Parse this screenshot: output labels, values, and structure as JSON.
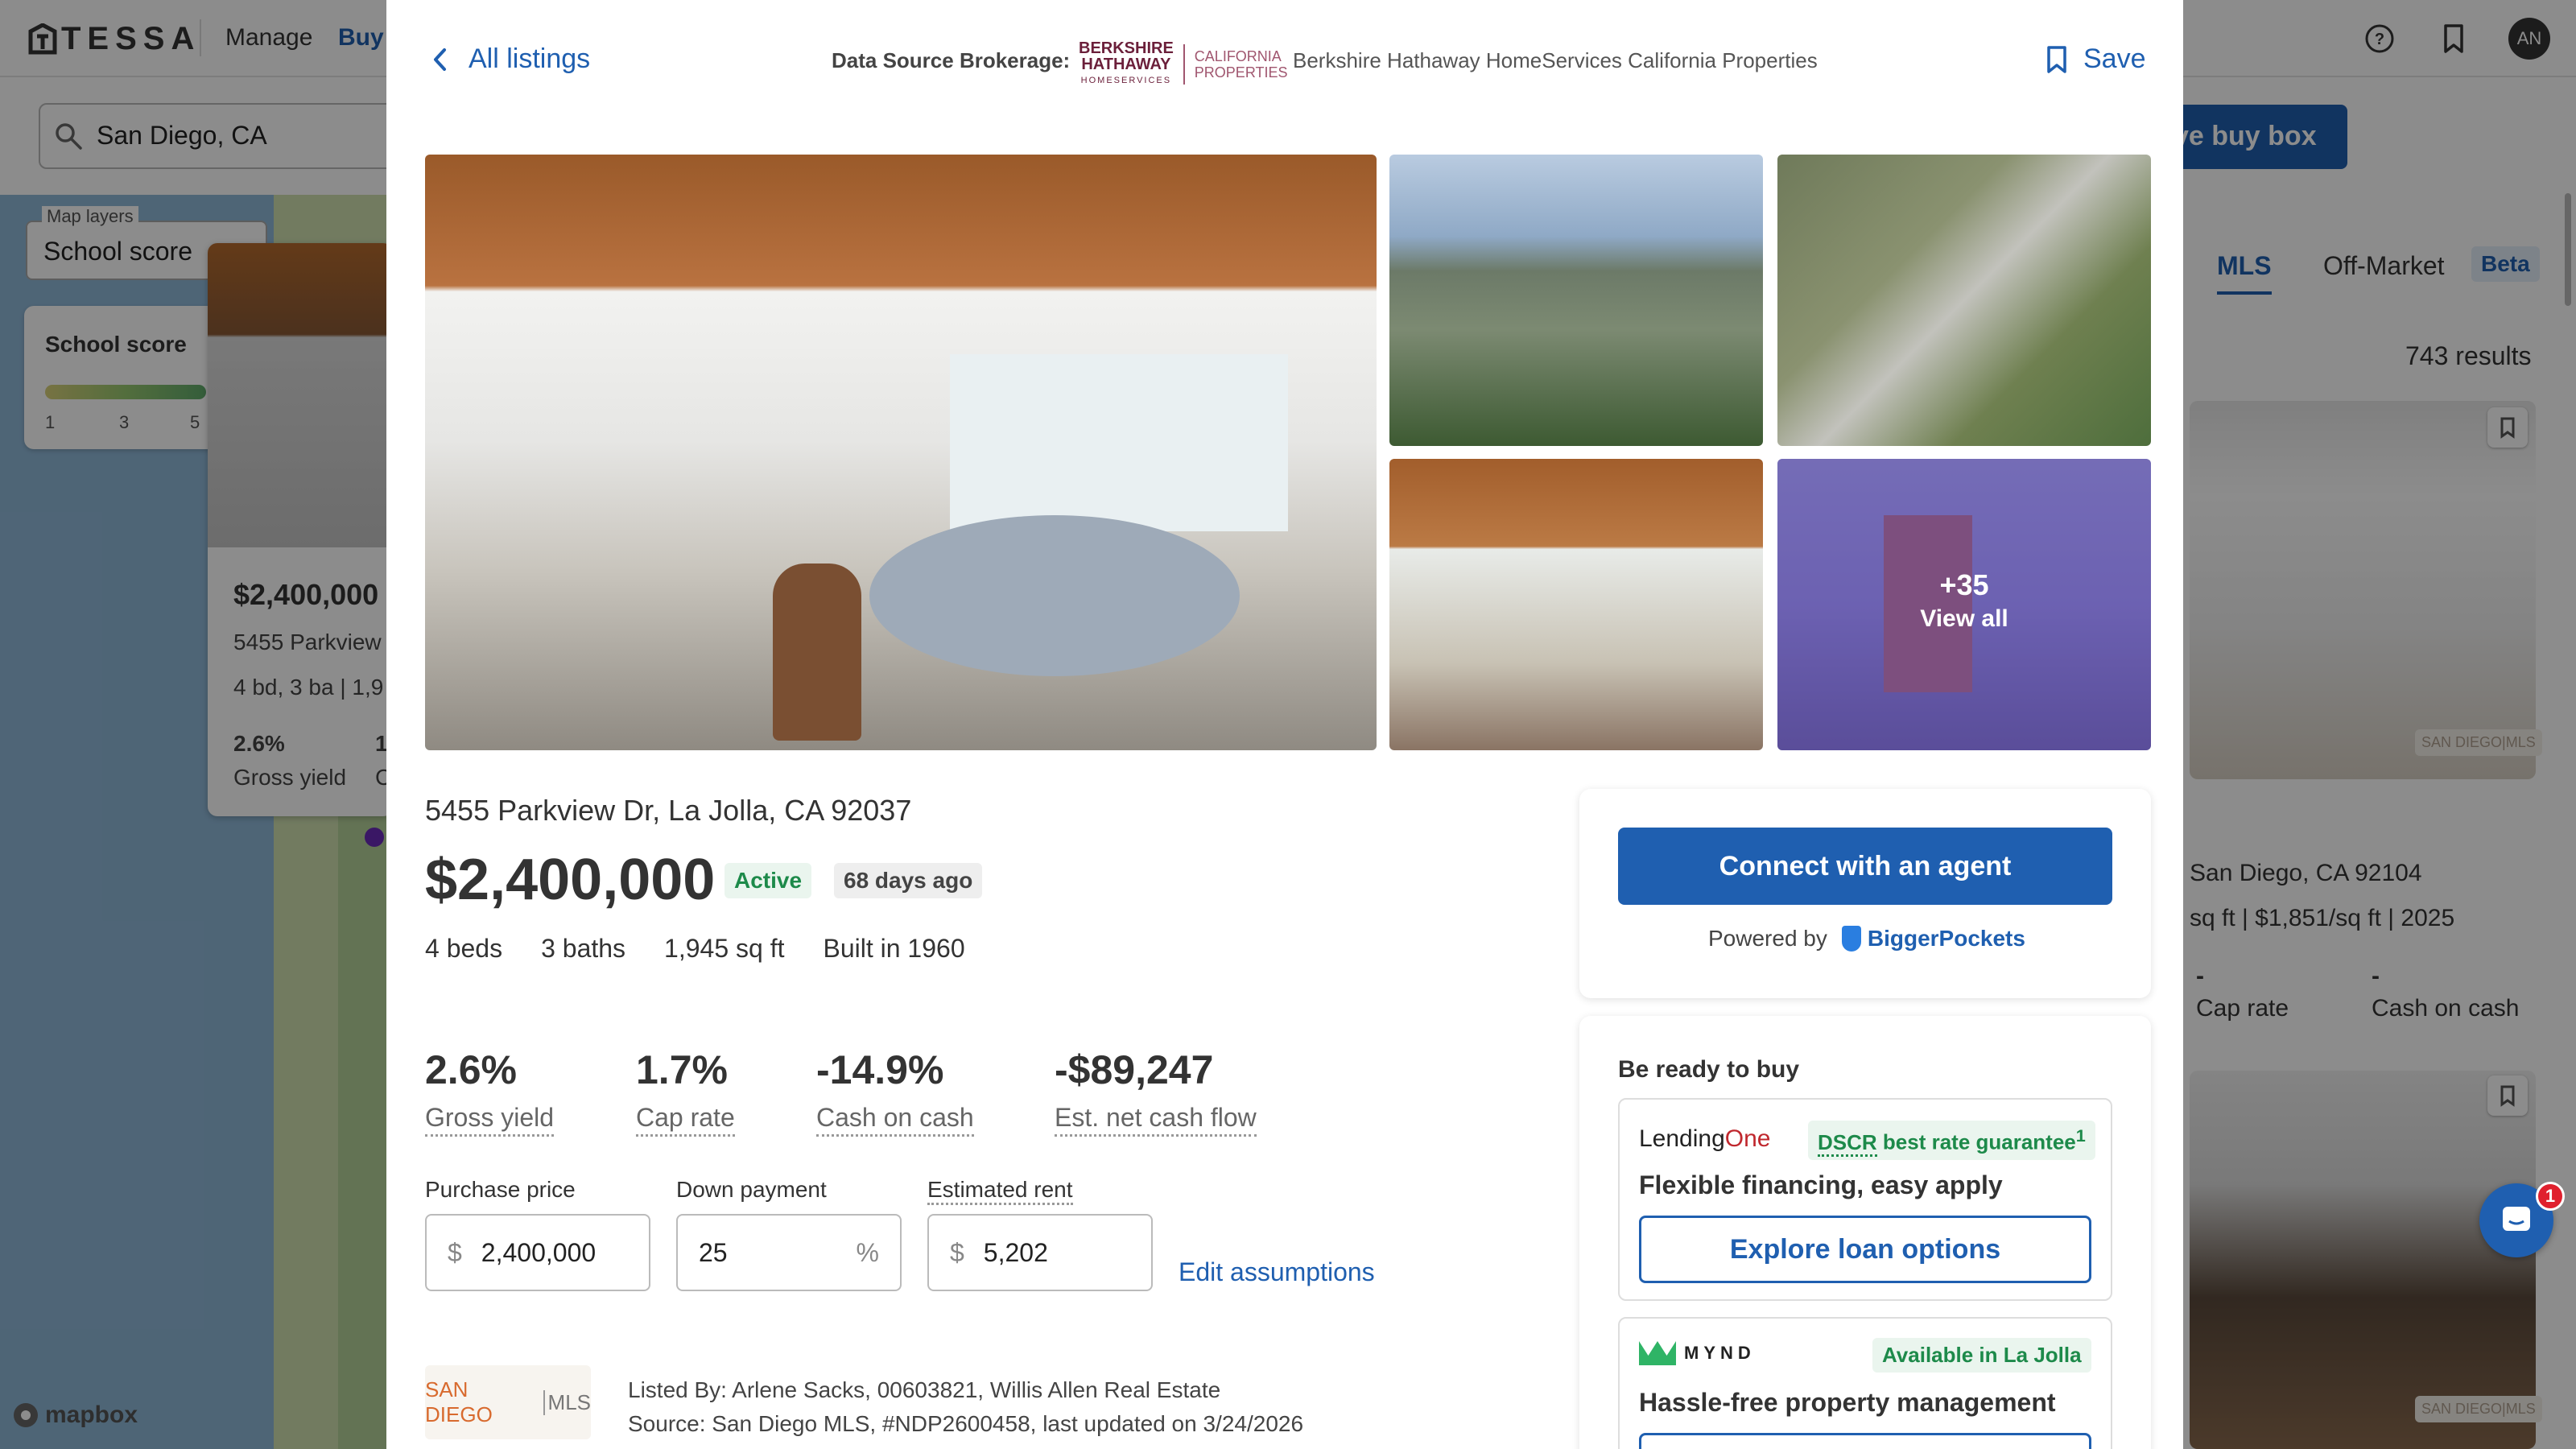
{
  "app": {
    "brand": "TESSA",
    "nav": {
      "manage": "Manage",
      "buy": "Buy"
    },
    "user_initials": "AN"
  },
  "search": {
    "value": "San Diego, CA"
  },
  "map": {
    "layers_label": "Map layers",
    "layers_value": "School score",
    "school_score_title": "School score",
    "school_ticks": [
      "1",
      "3",
      "5"
    ],
    "attribution": "mapbox",
    "listing_card": {
      "price": "$2,400,000",
      "address": "5455 Parkview",
      "beds_baths": "4 bd, 3 ba | 1,9",
      "gross_yield_value": "2.6%",
      "gross_yield_label": "Gross yield",
      "second_value": "1",
      "second_label": "C"
    }
  },
  "right_panel": {
    "buy_box_button": "ve buy box",
    "tabs": {
      "mls": "MLS",
      "off_market": "Off-Market",
      "beta": "Beta"
    },
    "results_count": "743 results",
    "card1": {
      "address": "San Diego, CA 92104",
      "details": "sq ft  |  $1,851/sq ft  |  2025",
      "cap_rate_value": "-",
      "cap_rate_label": "Cap rate",
      "cash_on_cash_value": "-",
      "cash_on_cash_label": "Cash on cash",
      "mls_tag": "SAN DIEGO|MLS"
    },
    "card2": {
      "mls_tag": "SAN DIEGO|MLS"
    },
    "chat_badge": "1"
  },
  "modal": {
    "back_label": "All listings",
    "data_source_label": "Data Source Brokerage:",
    "brokerage_logo": {
      "left_line1": "BERKSHIRE",
      "left_line2": "HATHAWAY",
      "left_line3": "HOMESERVICES",
      "right_line1": "CALIFORNIA",
      "right_line2": "PROPERTIES"
    },
    "brokerage_name": "Berkshire Hathaway HomeServices California Properties",
    "save_label": "Save",
    "photos": {
      "more_count": "+35",
      "view_all": "View all"
    },
    "address": "5455 Parkview Dr, La Jolla, CA 92037",
    "price": "$2,400,000",
    "status": "Active",
    "days_on_market": "68 days ago",
    "facts": {
      "beds": "4 beds",
      "baths": "3 baths",
      "sqft": "1,945 sq ft",
      "built": "Built in 1960"
    },
    "metrics": [
      {
        "value": "2.6%",
        "label": "Gross yield"
      },
      {
        "value": "1.7%",
        "label": "Cap rate"
      },
      {
        "value": "-14.9%",
        "label": "Cash on cash"
      },
      {
        "value": "-$89,247",
        "label": "Est. net cash flow"
      }
    ],
    "inputs": {
      "purchase_price": {
        "label": "Purchase price",
        "prefix": "$",
        "value": "2,400,000"
      },
      "down_payment": {
        "label": "Down payment",
        "value": "25",
        "suffix": "%"
      },
      "estimated_rent": {
        "label": "Estimated rent",
        "prefix": "$",
        "value": "5,202"
      }
    },
    "edit_assumptions": "Edit assumptions",
    "mls_logo": {
      "left": "SAN DIEGO",
      "right": "MLS"
    },
    "listed_by": "Listed By: Arlene Sacks, 00603821, Willis Allen Real Estate",
    "source": "Source: San Diego MLS, #NDP2600458, last updated on 3/24/2026",
    "agent_card": {
      "button": "Connect with an agent",
      "powered_by": "Powered by",
      "partner": "BiggerPockets"
    },
    "ready_card": {
      "title": "Be ready to buy",
      "lender": {
        "name_main": "Lending",
        "name_accent": "One",
        "badge_underlined": "DSCR",
        "badge_rest": " best rate guarantee",
        "badge_sup": "1",
        "tagline": "Flexible financing, easy apply",
        "button": "Explore loan options"
      },
      "pm": {
        "name": "MYND",
        "badge": "Available in La Jolla",
        "tagline": "Hassle-free property management"
      }
    }
  },
  "colors": {
    "accent": "#1f5fb0",
    "success": "#1d8a4a",
    "overlay": "rgba(0,0,0,0.45)",
    "badge_red": "#e0202e"
  }
}
